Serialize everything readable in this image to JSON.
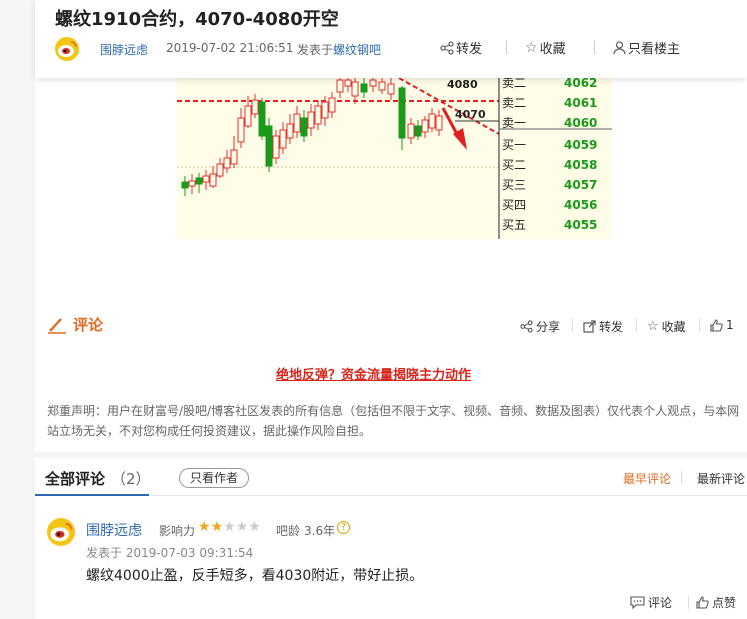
{
  "post": {
    "title": "螺纹1910合约，4070-4080开空",
    "author": "围脖远虑",
    "time": "2019-07-02 21:06:51",
    "published_in": "发表于",
    "bar": "螺纹钢吧",
    "actions": {
      "forward": "转发",
      "favorite": "收藏",
      "owner_only": "只看楼主"
    }
  },
  "chart_image": {
    "price_labels": [
      "4080",
      "4070"
    ],
    "order_book": [
      {
        "label": "卖二",
        "price": "4062"
      },
      {
        "label": "卖二",
        "price": "4061"
      },
      {
        "label": "卖一",
        "price": "4060"
      },
      {
        "label": "买一",
        "price": "4059"
      },
      {
        "label": "买二",
        "price": "4058"
      },
      {
        "label": "买三",
        "price": "4057"
      },
      {
        "label": "买四",
        "price": "4056"
      },
      {
        "label": "买五",
        "price": "4055"
      }
    ],
    "colors": {
      "up": "#e03030",
      "down": "#1a9a1a",
      "resistance": "#e02020"
    }
  },
  "comment_bar": {
    "title": "评论",
    "share": "分享",
    "forward": "转发",
    "favorite": "收藏",
    "like_count": "1"
  },
  "promo_link": "绝地反弹？资金流量揭晓主力动作",
  "disclaimer": "郑重声明：用户在财富号/股吧/博客社区发表的所有信息（包括但不限于文字、视频、音频、数据及图表）仅代表个人观点，与本网站立场无关，不对您构成任何投资建议，据此操作风险自担。",
  "comments": {
    "tab_label": "全部评论",
    "count": "（2）",
    "author_only": "只看作者",
    "sort_earliest": "最早评论",
    "sort_latest": "最新评论",
    "items": [
      {
        "author": "围脖远虑",
        "influence_label": "影响力",
        "stars_on": 2,
        "stars_total": 5,
        "age_label": "吧龄",
        "age": "3.6年",
        "time": "发表于 2019-07-03 09:31:54",
        "text": "螺纹4000止盈，反手短多，看4030附近，带好止损。",
        "reply": "评论",
        "like": "点赞"
      }
    ]
  }
}
